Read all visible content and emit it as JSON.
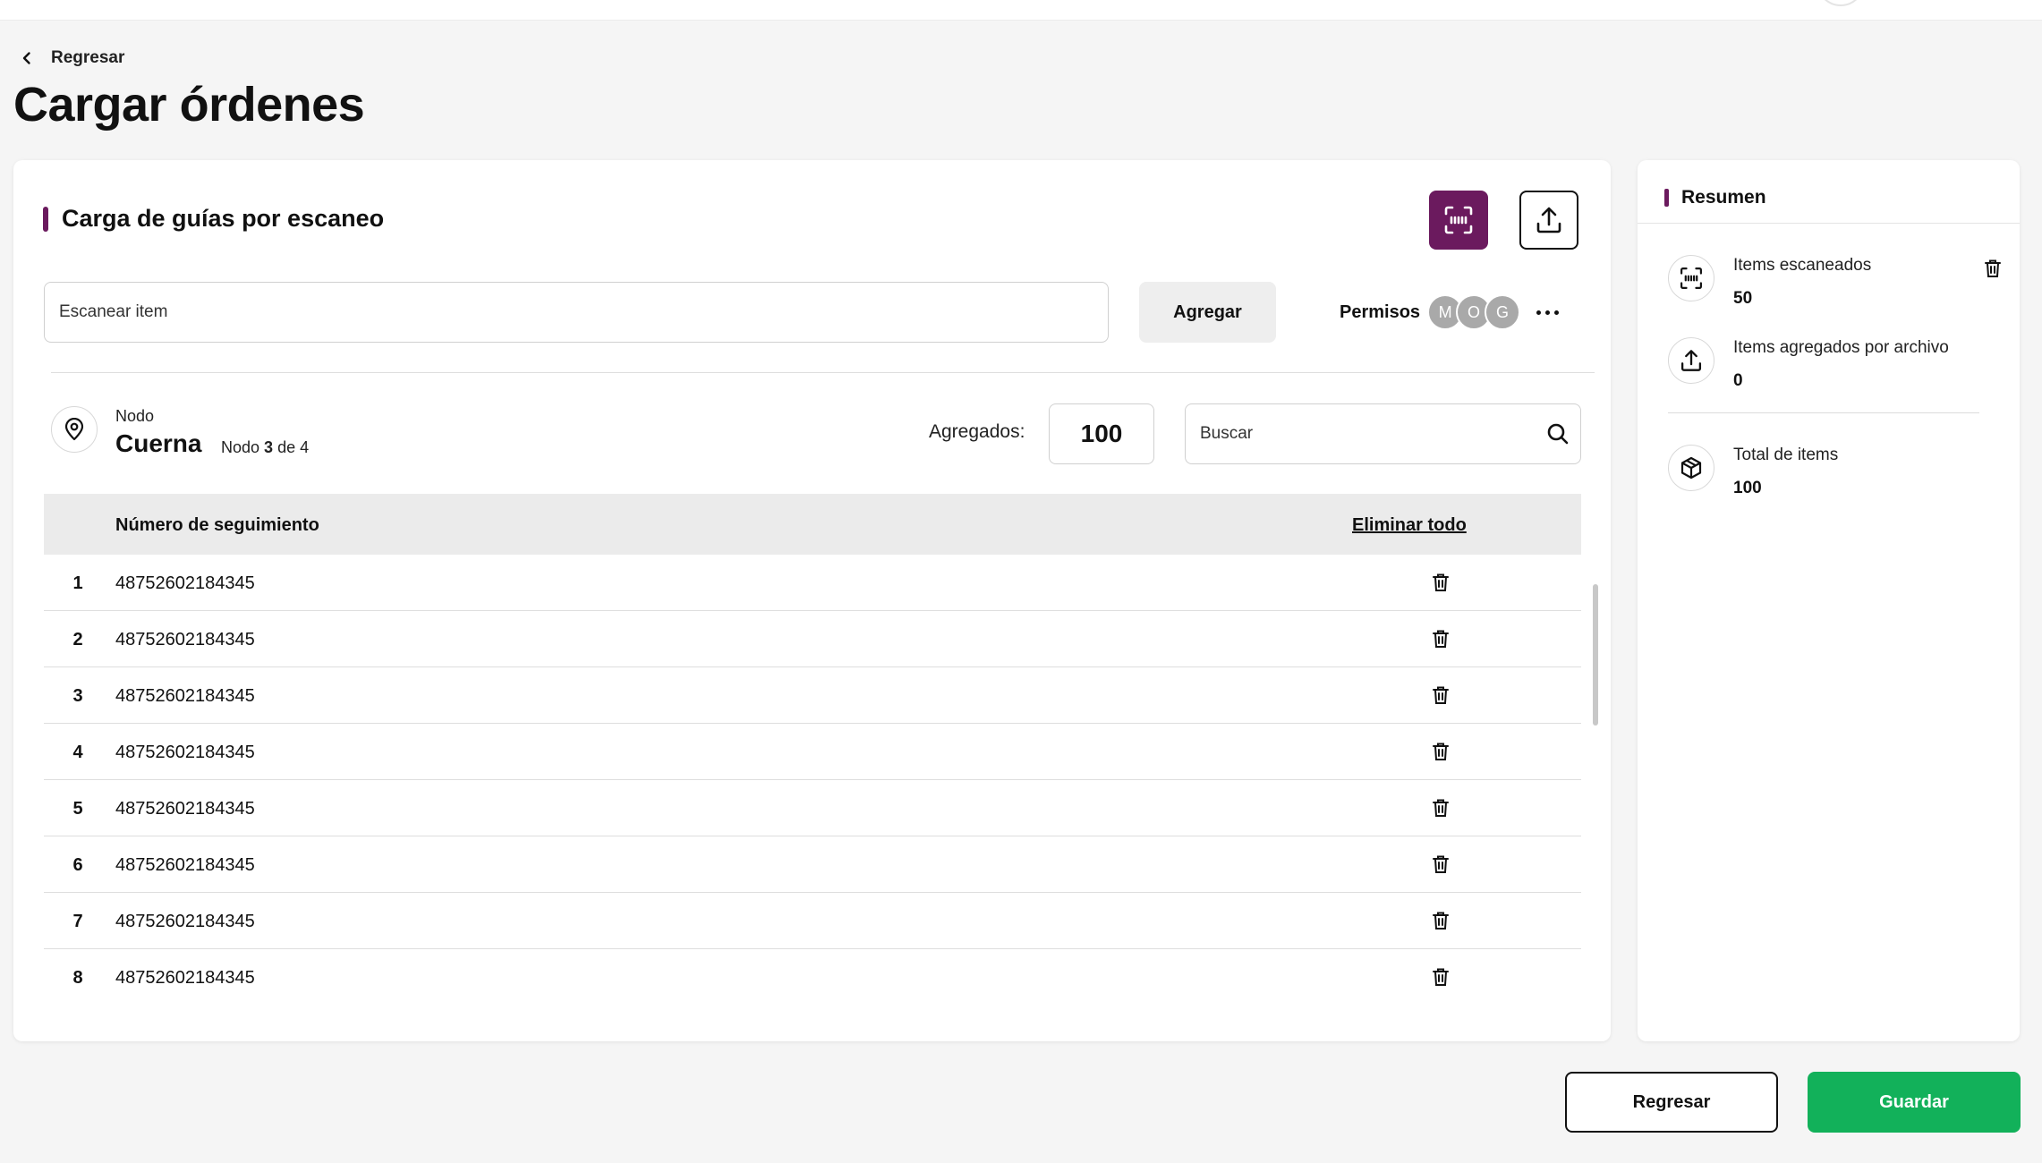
{
  "header": {
    "back_label": "Regresar",
    "page_title": "Cargar órdenes"
  },
  "main": {
    "section_title": "Carga de guías por escaneo",
    "scan_placeholder": "Escanear item",
    "add_label": "Agregar",
    "permissions": {
      "label": "Permisos",
      "avatars": [
        "M",
        "O",
        "G"
      ]
    },
    "node": {
      "label": "Nodo",
      "name": "Cuerna",
      "prefix": "Nodo",
      "current": "3",
      "separator": "de",
      "total": "4"
    },
    "added": {
      "label": "Agregados:",
      "value": "100"
    },
    "search_placeholder": "Buscar",
    "table": {
      "column_title": "Número de seguimiento",
      "delete_all_label": "Eliminar todo",
      "rows": [
        {
          "index": "1",
          "tracking": "48752602184345"
        },
        {
          "index": "2",
          "tracking": "48752602184345"
        },
        {
          "index": "3",
          "tracking": "48752602184345"
        },
        {
          "index": "4",
          "tracking": "48752602184345"
        },
        {
          "index": "5",
          "tracking": "48752602184345"
        },
        {
          "index": "6",
          "tracking": "48752602184345"
        },
        {
          "index": "7",
          "tracking": "48752602184345"
        },
        {
          "index": "8",
          "tracking": "48752602184345"
        }
      ]
    }
  },
  "summary": {
    "title": "Resumen",
    "scanned": {
      "label": "Items escaneados",
      "value": "50"
    },
    "file_added": {
      "label": "Items agregados por archivo",
      "value": "0"
    },
    "total": {
      "label": "Total de items",
      "value": "100"
    }
  },
  "footer": {
    "back_label": "Regresar",
    "save_label": "Guardar"
  },
  "icons": {
    "back": "chevron-left-icon",
    "scan": "scan-icon",
    "upload": "upload-icon",
    "location": "location-pin-icon",
    "search": "search-icon",
    "trash": "trash-icon",
    "box": "box-icon",
    "more": "more-horizontal-icon"
  },
  "colors": {
    "brand": "#6b1a5e",
    "save": "#12b15a"
  }
}
